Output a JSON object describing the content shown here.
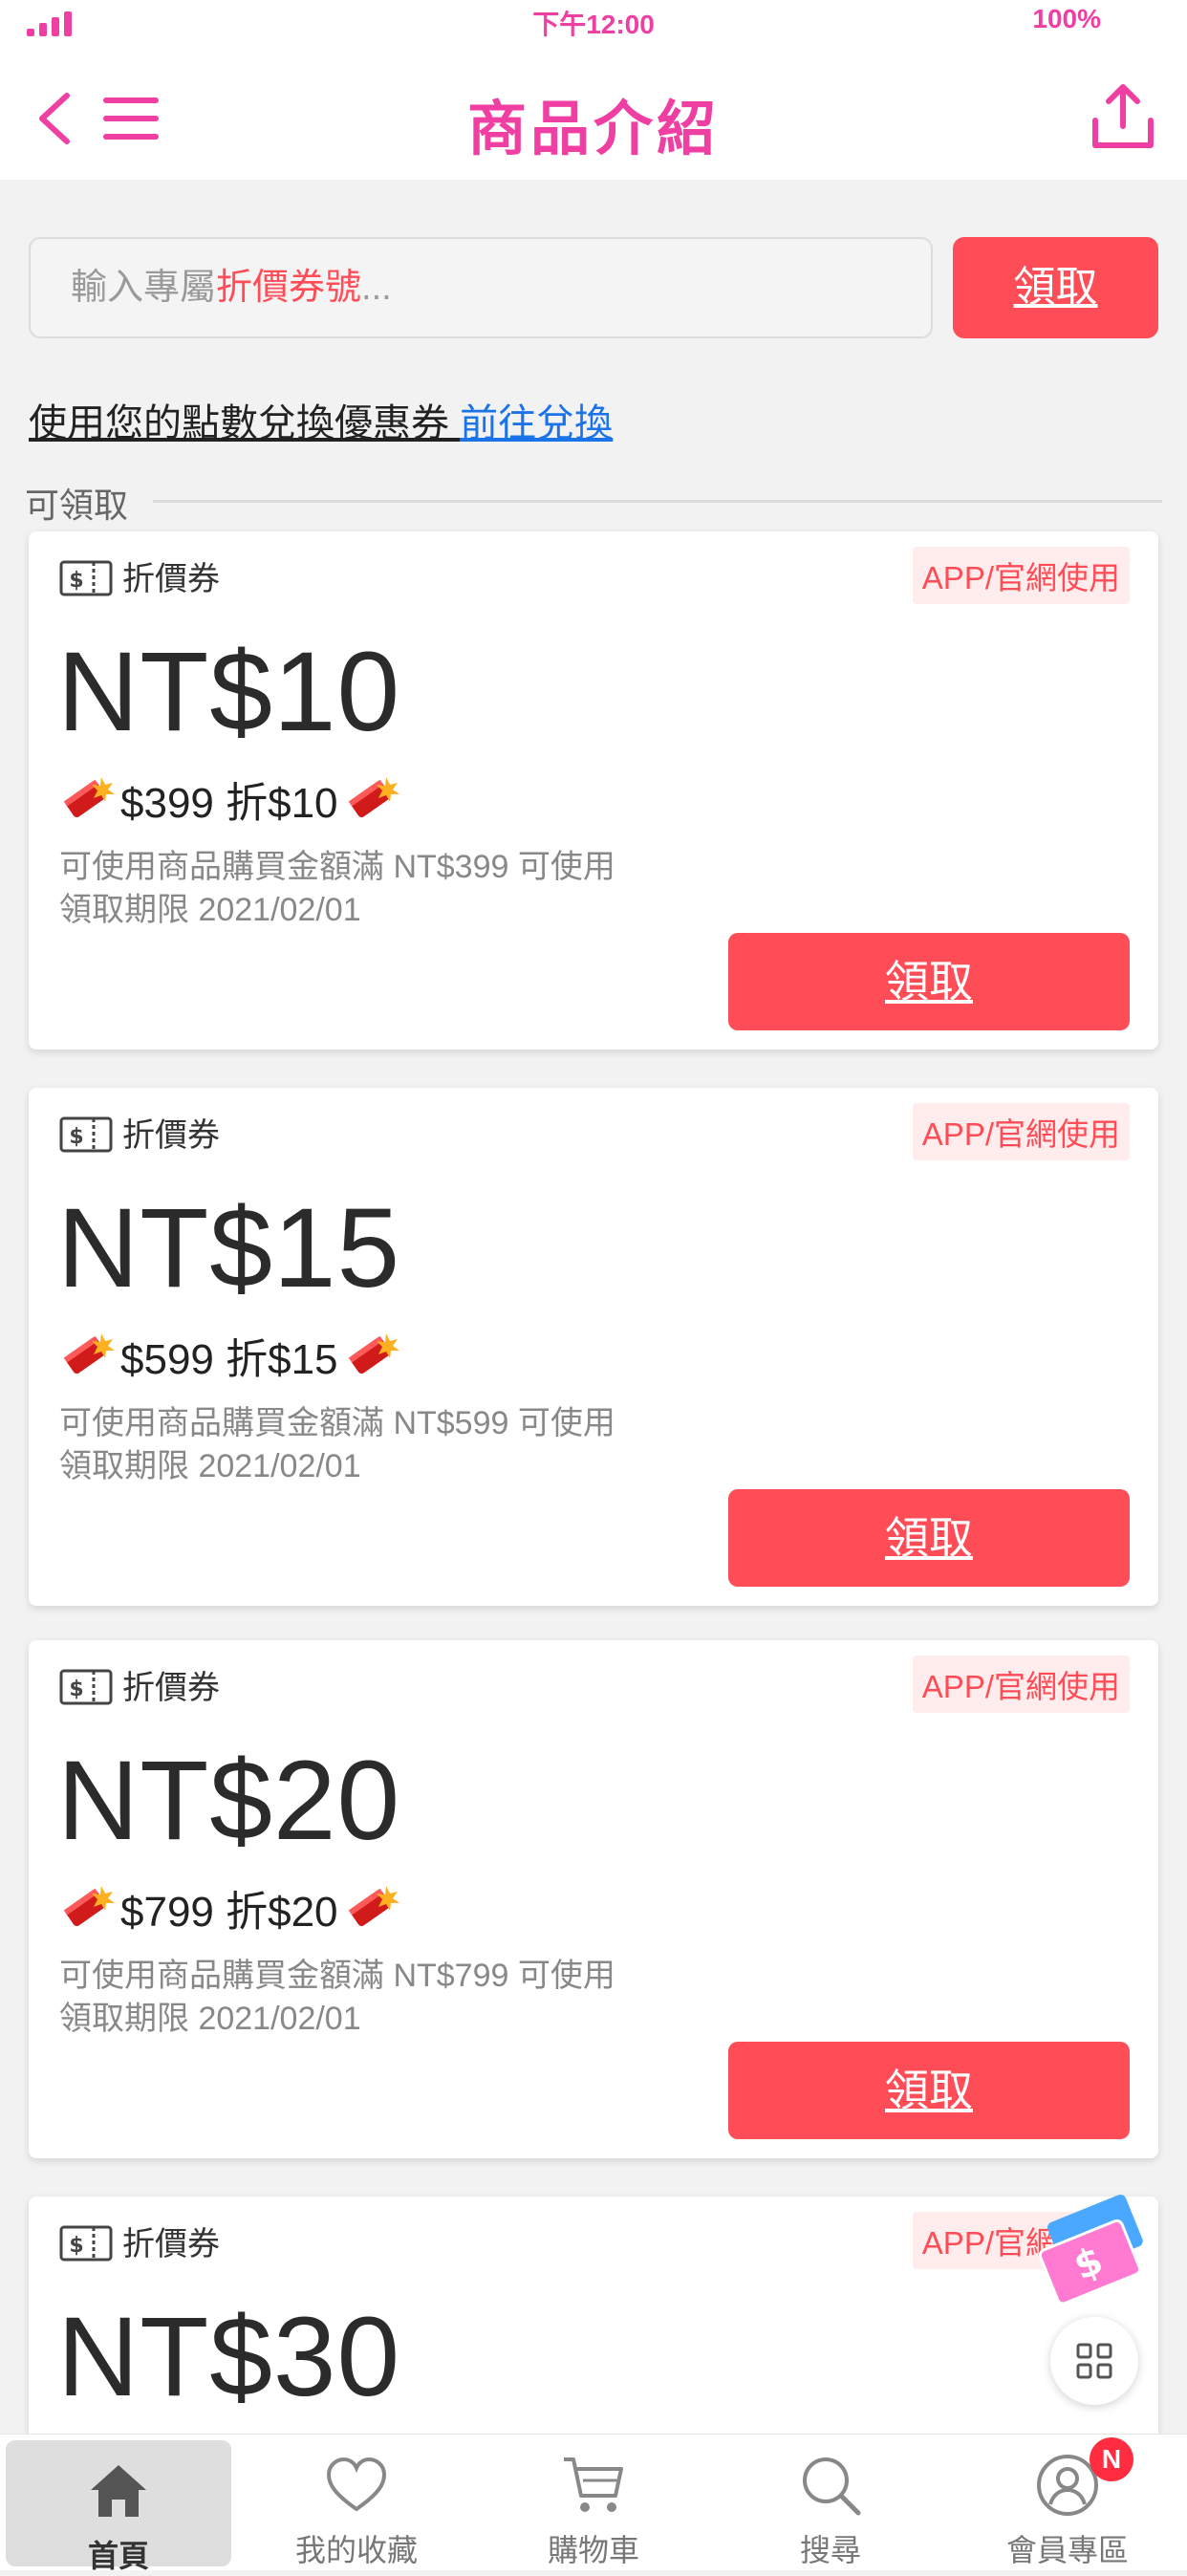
{
  "status_bar": {
    "time": "下午12:00",
    "battery": "100%"
  },
  "header": {
    "title": "商品介紹"
  },
  "coupon_input": {
    "placeholder_prefix": "輸入專屬",
    "placeholder_highlight": "折價券號",
    "placeholder_suffix": "...",
    "claim_label": "領取"
  },
  "points": {
    "text": "使用您的點數兌換優惠券 ",
    "link": "前往兌換"
  },
  "section": {
    "label": "可領取"
  },
  "coupons": [
    {
      "type": "折價券",
      "tag": "APP/官網使用",
      "amount": "NT$10",
      "promo": "$399 折$10",
      "condition": "可使用商品購買金額滿 NT$399 可使用",
      "deadline": "領取期限 2021/02/01",
      "button": "領取"
    },
    {
      "type": "折價券",
      "tag": "APP/官網使用",
      "amount": "NT$15",
      "promo": "$599 折$15",
      "condition": "可使用商品購買金額滿 NT$599 可使用",
      "deadline": "領取期限 2021/02/01",
      "button": "領取"
    },
    {
      "type": "折價券",
      "tag": "APP/官網使用",
      "amount": "NT$20",
      "promo": "$799 折$20",
      "condition": "可使用商品購買金額滿 NT$799 可使用",
      "deadline": "領取期限 2021/02/01",
      "button": "領取"
    },
    {
      "type": "折價券",
      "tag": "APP/官網使用",
      "amount": "NT$30"
    }
  ],
  "bottom_nav": {
    "items": [
      {
        "label": "首頁",
        "icon": "home-icon",
        "active": true
      },
      {
        "label": "我的收藏",
        "icon": "heart-icon"
      },
      {
        "label": "購物車",
        "icon": "cart-icon"
      },
      {
        "label": "搜尋",
        "icon": "search-icon"
      },
      {
        "label": "會員專區",
        "icon": "user-icon"
      }
    ],
    "badge": "N"
  },
  "colors": {
    "accent": "#f03fa3",
    "button": "#ff4d57",
    "link": "#1a73e8"
  }
}
